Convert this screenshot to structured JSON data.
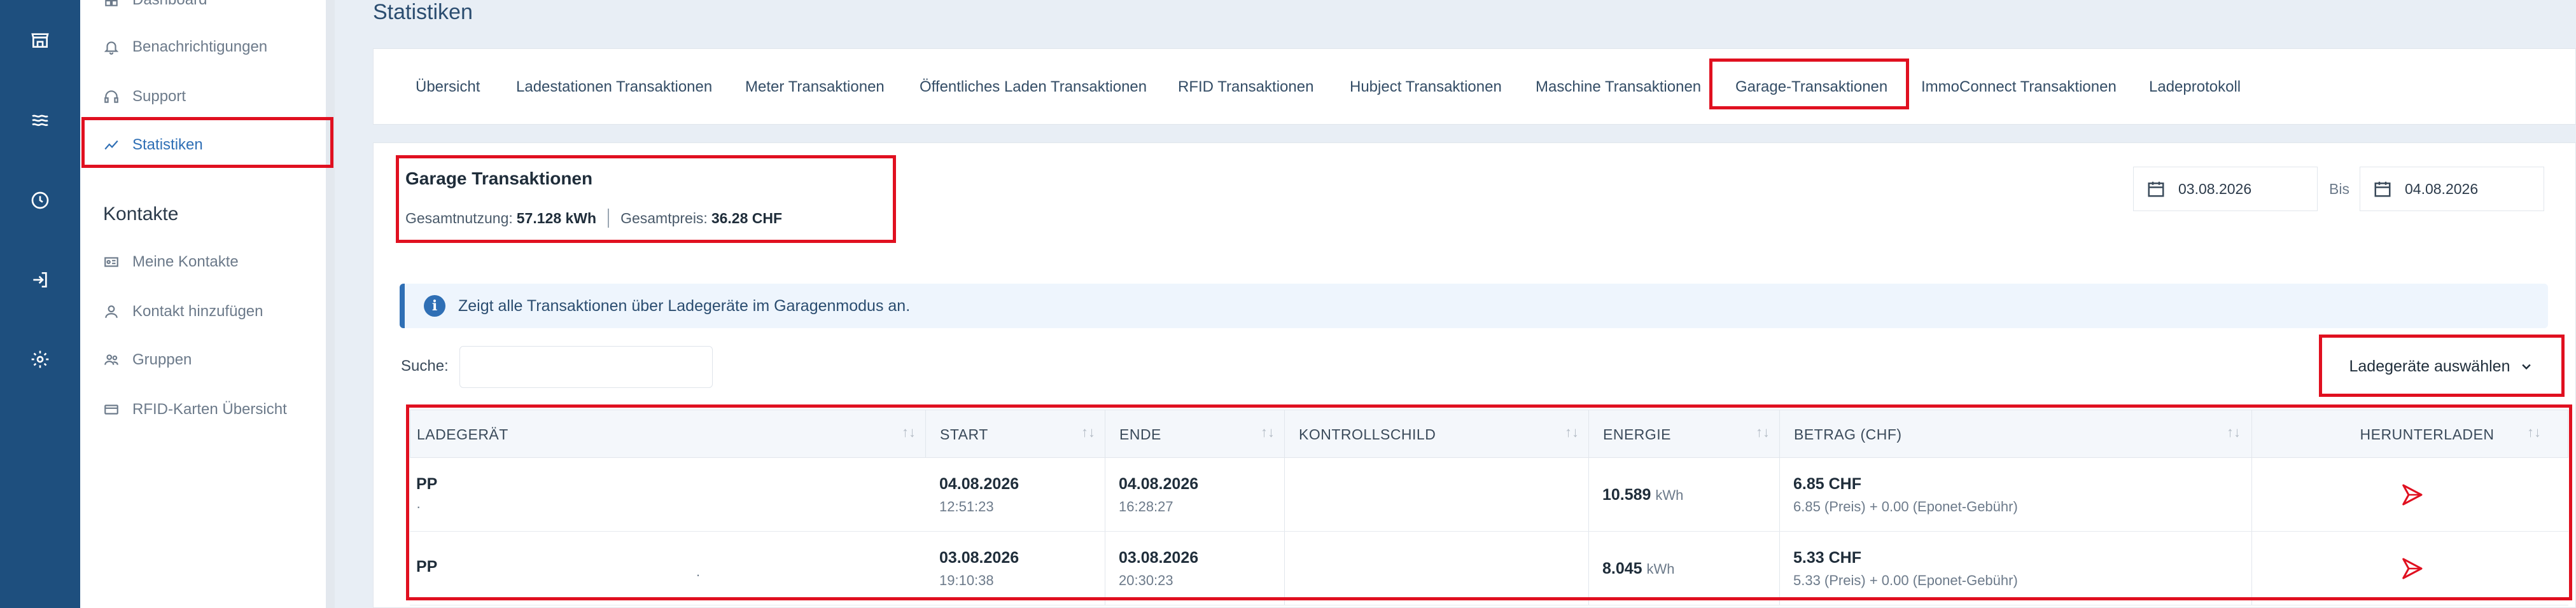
{
  "sidebar": {
    "items": [
      {
        "label": "Dashboard",
        "icon": "dashboard-icon"
      },
      {
        "label": "Benachrichtigungen",
        "icon": "bell-icon"
      },
      {
        "label": "Support",
        "icon": "headset-icon"
      },
      {
        "label": "Statistiken",
        "icon": "chart-line-icon",
        "active": true
      }
    ],
    "contacts_heading": "Kontakte",
    "contact_items": [
      {
        "label": "Meine Kontakte",
        "icon": "id-card-icon"
      },
      {
        "label": "Kontakt hinzufügen",
        "icon": "user-icon"
      },
      {
        "label": "Gruppen",
        "icon": "users-icon"
      },
      {
        "label": "RFID-Karten Übersicht",
        "icon": "card-icon"
      }
    ]
  },
  "rail": {
    "icons": [
      "store-icon",
      "waves-icon",
      "clock-icon",
      "login-icon",
      "gear-icon"
    ]
  },
  "page": {
    "title": "Statistiken"
  },
  "tabs": [
    "Übersicht",
    "Ladestationen Transaktionen",
    "Meter Transaktionen",
    "Öffentliches Laden Transaktionen",
    "RFID Transaktionen",
    "Hubject Transaktionen",
    "Maschine Transaktionen",
    "Garage-Transaktionen",
    "ImmoConnect Transaktionen",
    "Ladeprotokoll"
  ],
  "active_tab": "Garage-Transaktionen",
  "summary": {
    "title": "Garage Transaktionen",
    "usage_label": "Gesamtnutzung:",
    "usage_value": "57.128 kWh",
    "price_label": "Gesamtpreis:",
    "price_value": "36.28 CHF"
  },
  "date_range": {
    "from": "03.08.2026",
    "to_label": "Bis",
    "to": "04.08.2026"
  },
  "info": {
    "text": "Zeigt alle Transaktionen über Ladegeräte im Garagenmodus an."
  },
  "search": {
    "label": "Suche:",
    "value": ""
  },
  "charger_select": {
    "label": "Ladegeräte auswählen"
  },
  "table": {
    "columns": [
      "LADEGERÄT",
      "START",
      "ENDE",
      "KONTROLLSCHILD",
      "ENERGIE",
      "BETRAG (CHF)",
      "HERUNTERLADEN"
    ],
    "sort_symbol": "↑↓",
    "rows": [
      {
        "charger": "PP",
        "charger_sub": "·",
        "start_date": "04.08.2026",
        "start_time": "12:51:23",
        "end_date": "04.08.2026",
        "end_time": "16:28:27",
        "plate": "",
        "energy_value": "10.589",
        "energy_unit": "kWh",
        "amount": "6.85 CHF",
        "amount_detail": "6.85 (Preis)  +  0.00 (Eponet-Gebühr)"
      },
      {
        "charger": "PP",
        "charger_sub": ".",
        "start_date": "03.08.2026",
        "start_time": "19:10:38",
        "end_date": "03.08.2026",
        "end_time": "20:30:23",
        "plate": "",
        "energy_value": "8.045",
        "energy_unit": "kWh",
        "amount": "5.33 CHF",
        "amount_detail": "5.33 (Preis)  +  0.00 (Eponet-Gebühr)"
      }
    ]
  },
  "colors": {
    "accent": "#2f6fb5",
    "rail": "#1e4f7e",
    "highlight": "#e01020",
    "download": "#e01020"
  }
}
